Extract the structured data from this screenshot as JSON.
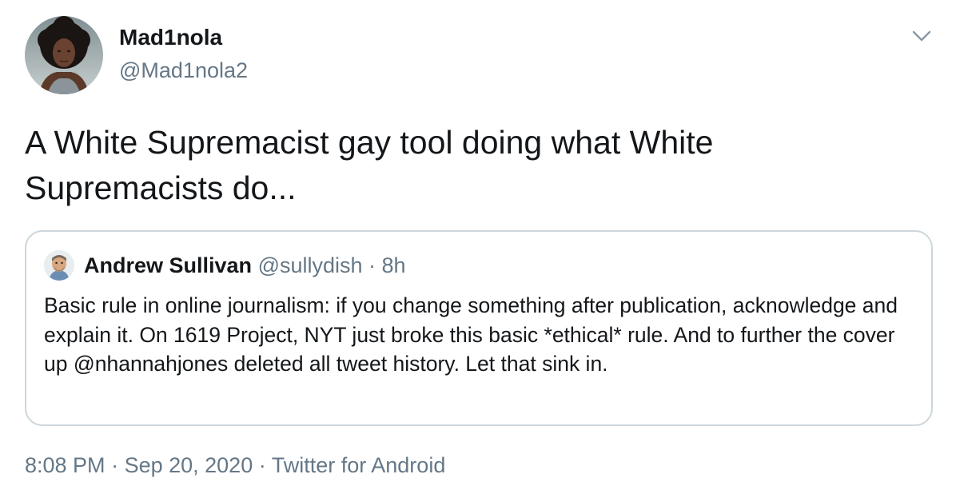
{
  "author": {
    "display_name": "Mad1nola",
    "handle": "@Mad1nola2"
  },
  "tweet": {
    "text": "A White Supremacist gay tool doing what White Supremacists do..."
  },
  "quoted_tweet": {
    "display_name": "Andrew Sullivan",
    "handle": "@sullydish",
    "separator": " · ",
    "age": "8h",
    "text": "Basic rule in online journalism: if you change something after publication, acknowledge and explain it. On 1619 Project, NYT just broke this basic *ethical* rule. And to further the cover up @nhannahjones deleted all tweet history. Let that sink in."
  },
  "footer": {
    "time": "8:08 PM",
    "separator": " · ",
    "date": "Sep 20, 2020",
    "separator2": " · ",
    "source": "Twitter for Android"
  },
  "colors": {
    "text_primary": "#14171a",
    "text_secondary": "#657786",
    "border": "#ccd6dd",
    "background": "#ffffff"
  },
  "icons": {
    "menu": "chevron-down-icon"
  }
}
